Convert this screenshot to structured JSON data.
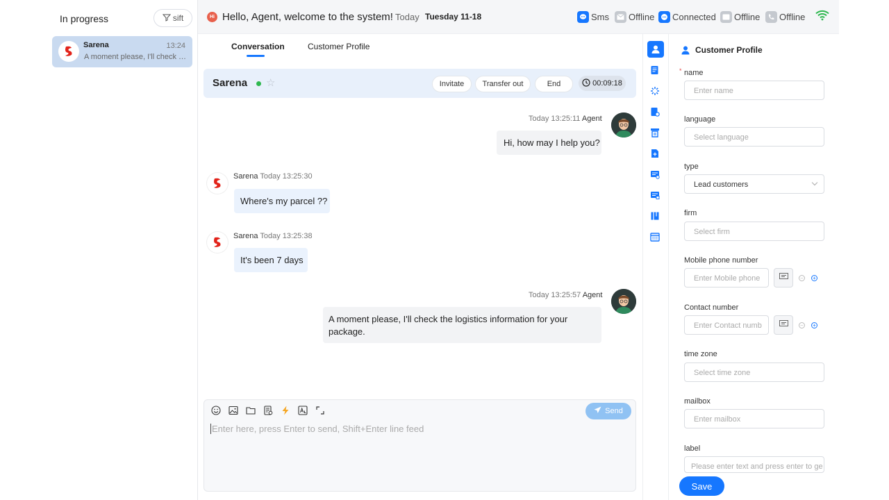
{
  "sidebar": {
    "heading": "In progress",
    "sift_label": "sift",
    "sessions": [
      {
        "name": "Sarena",
        "time": "13:24",
        "preview": "A moment please, I'll check the logistics information for your package."
      }
    ]
  },
  "header": {
    "greeting": "Hello, Agent, welcome to the system!",
    "hi_badge": "Hi",
    "today_label": "Today",
    "date": "Tuesday 11-18",
    "statuses": [
      {
        "icon": "sms-icon",
        "label": "Sms"
      },
      {
        "icon": "mail-icon",
        "label": "Offline"
      },
      {
        "icon": "chat-icon",
        "label": "Connected"
      },
      {
        "icon": "chat-box-icon",
        "label": "Offline"
      },
      {
        "icon": "phone-icon",
        "label": "Offline"
      }
    ],
    "colors": {
      "accent": "#1677ff",
      "wifi": "#2eb84f",
      "online_dot": "#2eb84f"
    }
  },
  "tabs": [
    {
      "label": "Conversation",
      "active": true
    },
    {
      "label": "Customer Profile",
      "active": false
    }
  ],
  "customer_bar": {
    "name": "Sarena",
    "actions": [
      "Invitate",
      "Transfer out",
      "End"
    ],
    "timer": "00:09:18"
  },
  "messages": [
    {
      "from": "agent",
      "time": "Today 13:25:11",
      "sender": "Agent",
      "text": "Hi, how may I help you?"
    },
    {
      "from": "customer",
      "sender": "Sarena",
      "time": "Today 13:25:30",
      "text": "Where's my parcel ??"
    },
    {
      "from": "customer",
      "sender": "Sarena",
      "time": "Today 13:25:38",
      "text": "It's been 7 days"
    },
    {
      "from": "agent",
      "time": "Today 13:25:57",
      "sender": "Agent",
      "text": "A moment please, I'll check the logistics information for your package."
    }
  ],
  "composer": {
    "placeholder": "Enter here, press Enter to send, Shift+Enter line feed",
    "send_label": "Send",
    "tools": [
      "emoji-icon",
      "image-icon",
      "folder-icon",
      "template-icon",
      "quick-reply-icon",
      "translate-icon",
      "expand-icon"
    ]
  },
  "profile": {
    "title": "Customer Profile",
    "fields": [
      {
        "label": "name",
        "placeholder": "Enter name",
        "required": true
      },
      {
        "label": "language",
        "placeholder": "Select language"
      },
      {
        "label": "type",
        "value": "Lead customers"
      },
      {
        "label": "firm",
        "placeholder": "Select firm"
      },
      {
        "label": "Mobile phone number",
        "placeholder": "Enter Mobile phone"
      },
      {
        "label": "Contact number",
        "placeholder": "Enter Contact numb"
      },
      {
        "label": "time zone",
        "placeholder": "Select time zone"
      },
      {
        "label": "mailbox",
        "placeholder": "Enter mailbox"
      },
      {
        "label": "label",
        "placeholder": "Please enter text and press enter to ge"
      }
    ],
    "save_label": "Save"
  }
}
